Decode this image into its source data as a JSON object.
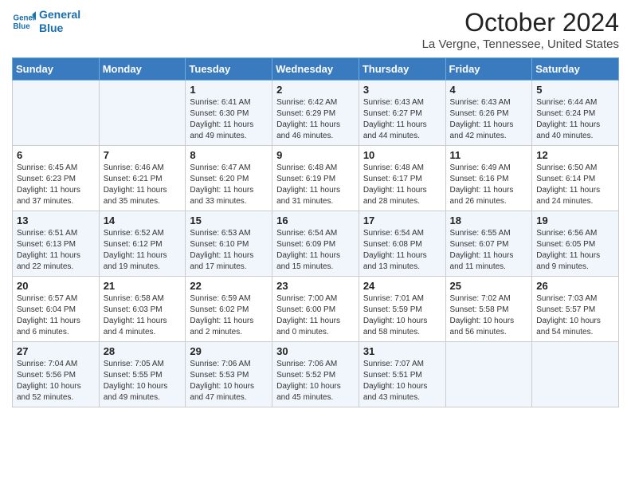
{
  "logo": {
    "line1": "General",
    "line2": "Blue"
  },
  "title": "October 2024",
  "location": "La Vergne, Tennessee, United States",
  "days_of_week": [
    "Sunday",
    "Monday",
    "Tuesday",
    "Wednesday",
    "Thursday",
    "Friday",
    "Saturday"
  ],
  "weeks": [
    [
      {
        "num": "",
        "info": ""
      },
      {
        "num": "",
        "info": ""
      },
      {
        "num": "1",
        "info": "Sunrise: 6:41 AM\nSunset: 6:30 PM\nDaylight: 11 hours and 49 minutes."
      },
      {
        "num": "2",
        "info": "Sunrise: 6:42 AM\nSunset: 6:29 PM\nDaylight: 11 hours and 46 minutes."
      },
      {
        "num": "3",
        "info": "Sunrise: 6:43 AM\nSunset: 6:27 PM\nDaylight: 11 hours and 44 minutes."
      },
      {
        "num": "4",
        "info": "Sunrise: 6:43 AM\nSunset: 6:26 PM\nDaylight: 11 hours and 42 minutes."
      },
      {
        "num": "5",
        "info": "Sunrise: 6:44 AM\nSunset: 6:24 PM\nDaylight: 11 hours and 40 minutes."
      }
    ],
    [
      {
        "num": "6",
        "info": "Sunrise: 6:45 AM\nSunset: 6:23 PM\nDaylight: 11 hours and 37 minutes."
      },
      {
        "num": "7",
        "info": "Sunrise: 6:46 AM\nSunset: 6:21 PM\nDaylight: 11 hours and 35 minutes."
      },
      {
        "num": "8",
        "info": "Sunrise: 6:47 AM\nSunset: 6:20 PM\nDaylight: 11 hours and 33 minutes."
      },
      {
        "num": "9",
        "info": "Sunrise: 6:48 AM\nSunset: 6:19 PM\nDaylight: 11 hours and 31 minutes."
      },
      {
        "num": "10",
        "info": "Sunrise: 6:48 AM\nSunset: 6:17 PM\nDaylight: 11 hours and 28 minutes."
      },
      {
        "num": "11",
        "info": "Sunrise: 6:49 AM\nSunset: 6:16 PM\nDaylight: 11 hours and 26 minutes."
      },
      {
        "num": "12",
        "info": "Sunrise: 6:50 AM\nSunset: 6:14 PM\nDaylight: 11 hours and 24 minutes."
      }
    ],
    [
      {
        "num": "13",
        "info": "Sunrise: 6:51 AM\nSunset: 6:13 PM\nDaylight: 11 hours and 22 minutes."
      },
      {
        "num": "14",
        "info": "Sunrise: 6:52 AM\nSunset: 6:12 PM\nDaylight: 11 hours and 19 minutes."
      },
      {
        "num": "15",
        "info": "Sunrise: 6:53 AM\nSunset: 6:10 PM\nDaylight: 11 hours and 17 minutes."
      },
      {
        "num": "16",
        "info": "Sunrise: 6:54 AM\nSunset: 6:09 PM\nDaylight: 11 hours and 15 minutes."
      },
      {
        "num": "17",
        "info": "Sunrise: 6:54 AM\nSunset: 6:08 PM\nDaylight: 11 hours and 13 minutes."
      },
      {
        "num": "18",
        "info": "Sunrise: 6:55 AM\nSunset: 6:07 PM\nDaylight: 11 hours and 11 minutes."
      },
      {
        "num": "19",
        "info": "Sunrise: 6:56 AM\nSunset: 6:05 PM\nDaylight: 11 hours and 9 minutes."
      }
    ],
    [
      {
        "num": "20",
        "info": "Sunrise: 6:57 AM\nSunset: 6:04 PM\nDaylight: 11 hours and 6 minutes."
      },
      {
        "num": "21",
        "info": "Sunrise: 6:58 AM\nSunset: 6:03 PM\nDaylight: 11 hours and 4 minutes."
      },
      {
        "num": "22",
        "info": "Sunrise: 6:59 AM\nSunset: 6:02 PM\nDaylight: 11 hours and 2 minutes."
      },
      {
        "num": "23",
        "info": "Sunrise: 7:00 AM\nSunset: 6:00 PM\nDaylight: 11 hours and 0 minutes."
      },
      {
        "num": "24",
        "info": "Sunrise: 7:01 AM\nSunset: 5:59 PM\nDaylight: 10 hours and 58 minutes."
      },
      {
        "num": "25",
        "info": "Sunrise: 7:02 AM\nSunset: 5:58 PM\nDaylight: 10 hours and 56 minutes."
      },
      {
        "num": "26",
        "info": "Sunrise: 7:03 AM\nSunset: 5:57 PM\nDaylight: 10 hours and 54 minutes."
      }
    ],
    [
      {
        "num": "27",
        "info": "Sunrise: 7:04 AM\nSunset: 5:56 PM\nDaylight: 10 hours and 52 minutes."
      },
      {
        "num": "28",
        "info": "Sunrise: 7:05 AM\nSunset: 5:55 PM\nDaylight: 10 hours and 49 minutes."
      },
      {
        "num": "29",
        "info": "Sunrise: 7:06 AM\nSunset: 5:53 PM\nDaylight: 10 hours and 47 minutes."
      },
      {
        "num": "30",
        "info": "Sunrise: 7:06 AM\nSunset: 5:52 PM\nDaylight: 10 hours and 45 minutes."
      },
      {
        "num": "31",
        "info": "Sunrise: 7:07 AM\nSunset: 5:51 PM\nDaylight: 10 hours and 43 minutes."
      },
      {
        "num": "",
        "info": ""
      },
      {
        "num": "",
        "info": ""
      }
    ]
  ]
}
